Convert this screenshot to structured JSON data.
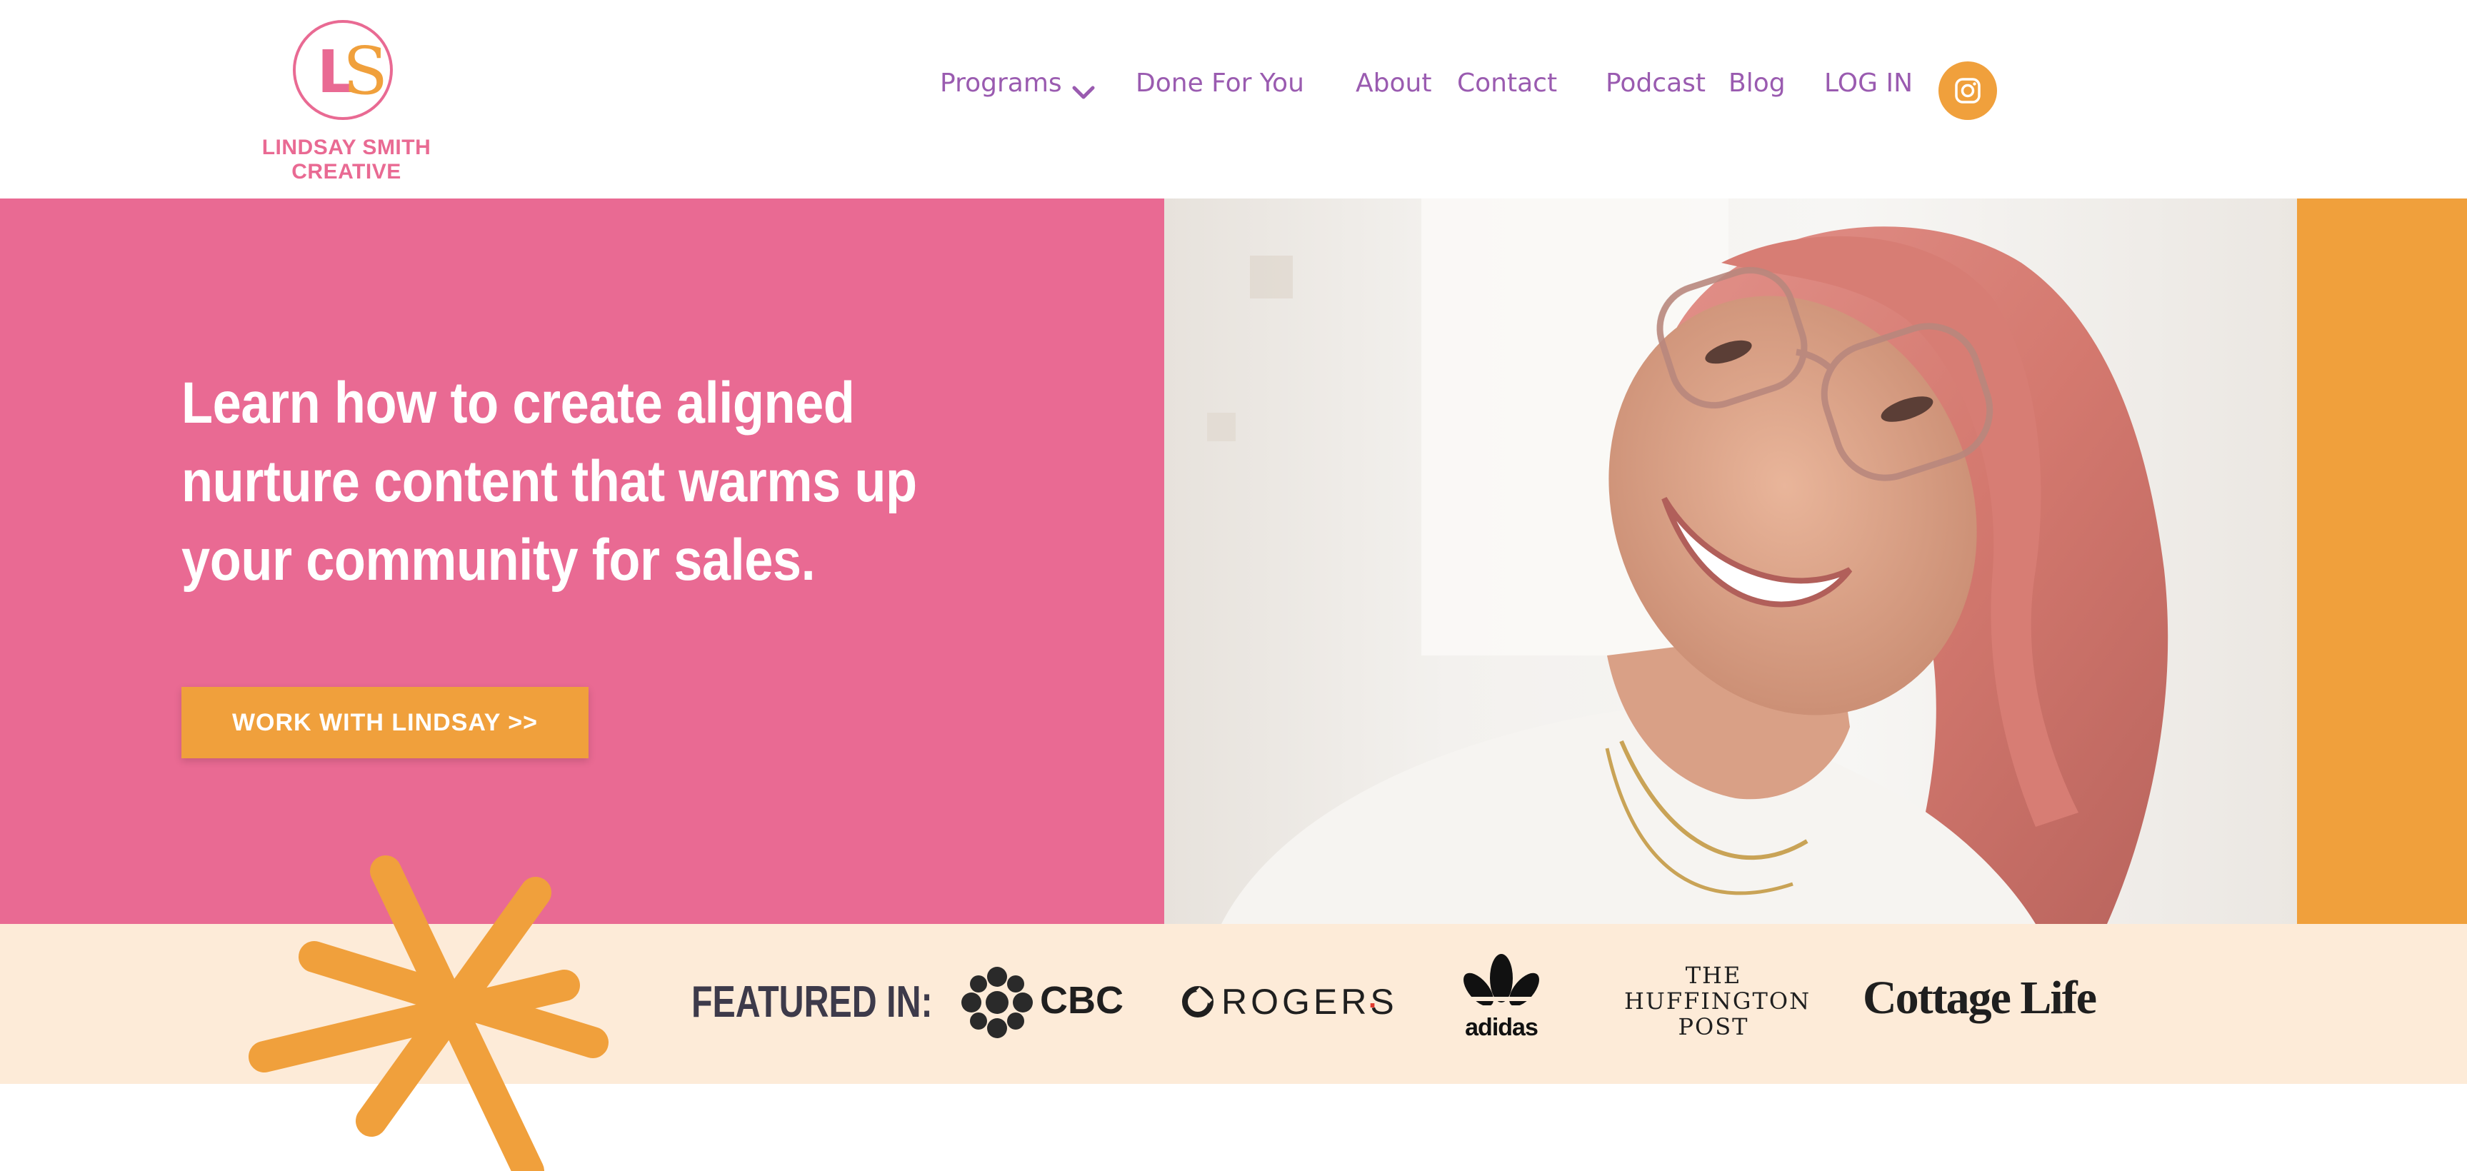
{
  "brand": {
    "monogram_l": "L",
    "monogram_s": "S",
    "name": "LINDSAY SMITH CREATIVE",
    "pink": "#e96a93",
    "orange": "#f0a03c",
    "purple": "#9a5bb0"
  },
  "nav": {
    "items": [
      {
        "label": "Programs",
        "has_dropdown": true
      },
      {
        "label": "Done For You"
      },
      {
        "label": "About"
      },
      {
        "label": "Contact"
      },
      {
        "label": "Podcast"
      },
      {
        "label": "Blog"
      },
      {
        "label": "LOG IN"
      }
    ],
    "social_icon": "instagram-icon"
  },
  "hero": {
    "headline_lines": [
      "Learn how to create aligned",
      "nurture content that warms up",
      "your community for sales."
    ],
    "cta_label": "WORK WITH LINDSAY >>"
  },
  "featured": {
    "label": "FEATURED IN:",
    "logos": {
      "cbc": "CBC",
      "rogers": "ROGERS",
      "rogers_mark": ".",
      "adidas": "adidas",
      "huffington": [
        "THE",
        "HUFFINGTON",
        "POST"
      ],
      "cottage": "Cottage Life"
    }
  }
}
